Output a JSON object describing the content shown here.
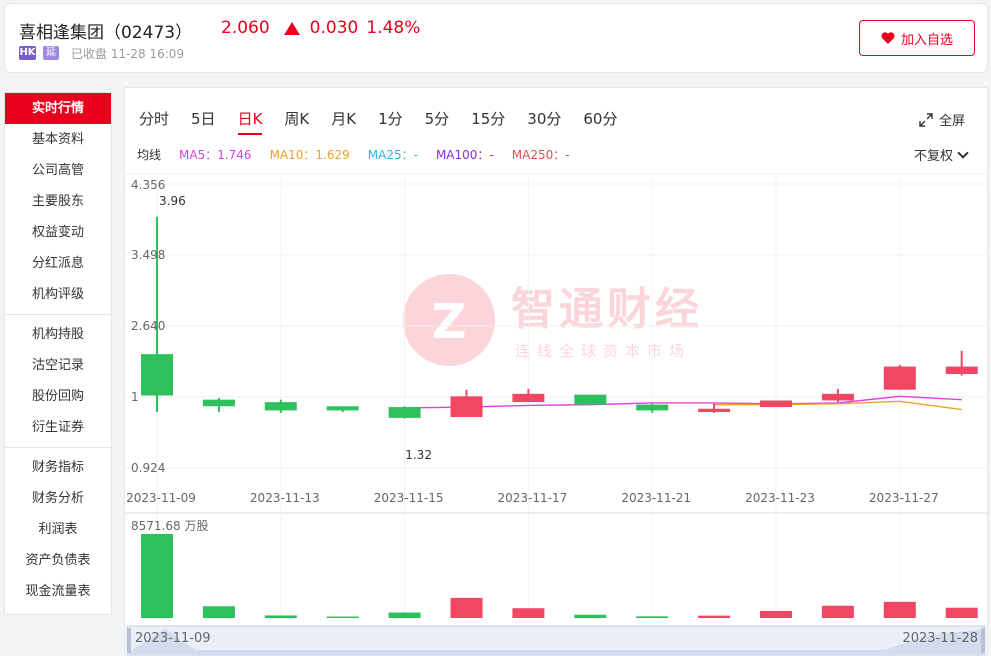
{
  "header": {
    "stock_name": "喜相逢集团（02473）",
    "price": "2.060",
    "change": "0.030",
    "change_pct": "1.48%",
    "market_badge": "HK",
    "delay_badge": "延",
    "status": "已收盘 11-28 16:09",
    "follow_label": "加入自选",
    "up_color": "#e8001c"
  },
  "sidebar": {
    "items": [
      {
        "label": "实时行情",
        "active": true
      },
      {
        "label": "基本资料"
      },
      {
        "label": "公司高管"
      },
      {
        "label": "主要股东"
      },
      {
        "label": "权益变动"
      },
      {
        "label": "分红派息"
      },
      {
        "label": "机构评级"
      },
      {
        "label": "机构持股"
      },
      {
        "label": "沽空记录"
      },
      {
        "label": "股份回购"
      },
      {
        "label": "衍生证券"
      },
      {
        "label": "财务指标"
      },
      {
        "label": "财务分析"
      },
      {
        "label": "利润表"
      },
      {
        "label": "资产负债表"
      },
      {
        "label": "现金流量表"
      }
    ]
  },
  "tabs": {
    "items": [
      "分时",
      "5日",
      "日K",
      "周K",
      "月K",
      "1分",
      "5分",
      "15分",
      "30分",
      "60分"
    ],
    "active": "日K",
    "fullscreen_label": "全屏"
  },
  "ma": {
    "label": "均线",
    "ma5": "MA5：1.746",
    "ma10": "MA10：1.629",
    "ma25": "MA25：-",
    "ma100": "MA100：-",
    "ma250": "MA250：-",
    "colors": {
      "ma5": "#e040e0",
      "ma10": "#f0a030",
      "ma25": "#30b8e0",
      "ma100": "#8a2be2",
      "ma250": "#e05050"
    },
    "restore_label": "不复权"
  },
  "watermark": {
    "title": "智通财经",
    "subtitle": "连线全球资本市场"
  },
  "chart_data": [
    {
      "type": "candlestick",
      "y_ticks": [
        "4.356",
        "3.498",
        "2.640",
        "1",
        "0.924"
      ],
      "ylim": [
        0.924,
        4.356
      ],
      "x_tick_labels": [
        "2023-11-09",
        "2023-11-13",
        "2023-11-15",
        "2023-11-17",
        "2023-11-21",
        "2023-11-23",
        "2023-11-27"
      ],
      "annotations": {
        "high": "3.96",
        "low": "1.32"
      },
      "up_color": "#f04864",
      "down_color": "#2ec05c",
      "candles": [
        {
          "date": "2023-11-09",
          "open": 2.3,
          "close": 1.8,
          "high": 3.96,
          "low": 1.6
        },
        {
          "date": "2023-11-10",
          "open": 1.75,
          "close": 1.67,
          "high": 1.77,
          "low": 1.6
        },
        {
          "date": "2023-11-13",
          "open": 1.72,
          "close": 1.62,
          "high": 1.75,
          "low": 1.59
        },
        {
          "date": "2023-11-14",
          "open": 1.67,
          "close": 1.62,
          "high": 1.67,
          "low": 1.6
        },
        {
          "date": "2023-11-15",
          "open": 1.66,
          "close": 1.53,
          "high": 1.67,
          "low": 1.52
        },
        {
          "date": "2023-11-16",
          "open": 1.54,
          "close": 1.79,
          "high": 1.87,
          "low": 1.54
        },
        {
          "date": "2023-11-17",
          "open": 1.72,
          "close": 1.82,
          "high": 1.88,
          "low": 1.72
        },
        {
          "date": "2023-11-20",
          "open": 1.81,
          "close": 1.69,
          "high": 1.81,
          "low": 1.69
        },
        {
          "date": "2023-11-21",
          "open": 1.69,
          "close": 1.62,
          "high": 1.7,
          "low": 1.59
        },
        {
          "date": "2023-11-22",
          "open": 1.6,
          "close": 1.64,
          "high": 1.7,
          "low": 1.59
        },
        {
          "date": "2023-11-23",
          "open": 1.66,
          "close": 1.74,
          "high": 1.74,
          "low": 1.66
        },
        {
          "date": "2023-11-24",
          "open": 1.74,
          "close": 1.82,
          "high": 1.88,
          "low": 1.72
        },
        {
          "date": "2023-11-27",
          "open": 1.87,
          "close": 2.15,
          "high": 2.17,
          "low": 1.87
        },
        {
          "date": "2023-11-28",
          "open": 2.06,
          "close": 2.15,
          "high": 2.34,
          "low": 2.04
        }
      ],
      "ma5": [
        null,
        null,
        null,
        null,
        1.65,
        1.66,
        1.68,
        1.69,
        1.71,
        1.71,
        1.7,
        1.71,
        1.79,
        1.75
      ],
      "ma10": [
        null,
        null,
        null,
        null,
        null,
        null,
        null,
        null,
        null,
        1.69,
        1.69,
        1.7,
        1.73,
        1.63
      ]
    },
    {
      "type": "bar",
      "title": "8571.68 万股",
      "unit": "万股",
      "ymax": 8571.68,
      "values": [
        8571.68,
        1200,
        260,
        150,
        560,
        2050,
        1000,
        330,
        170,
        240,
        720,
        1250,
        1650,
        1050
      ],
      "directions": [
        "down",
        "down",
        "down",
        "down",
        "down",
        "up",
        "up",
        "down",
        "down",
        "up",
        "up",
        "up",
        "up",
        "up"
      ],
      "range_start": "2023-11-09",
      "range_end": "2023-11-28"
    }
  ]
}
